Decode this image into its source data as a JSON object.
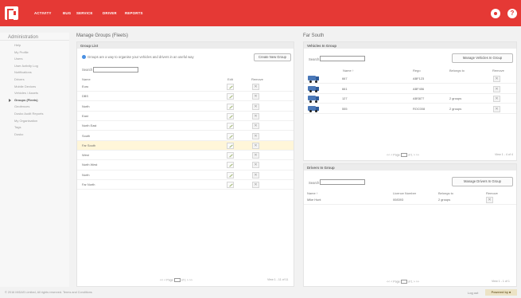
{
  "topbar": {
    "nav": [
      "ACTIVITY",
      "BUG",
      "SERVICE",
      "DRIVER",
      "REPORTS"
    ],
    "help_label": "?"
  },
  "sidebar": {
    "title": "Administration",
    "items": [
      "Help",
      "My Profile",
      "Users",
      "User Activity Log",
      "Notifications",
      "Drivers",
      "Mobile Devices",
      "Vehicles / Assets",
      "Groups (Fleets)",
      "Geofences",
      "Dusko Audit Reports",
      "My Organisation",
      "Tags",
      "Dusko"
    ]
  },
  "left": {
    "title": "Manage Groups (Fleets)",
    "list_header": "Group List",
    "info_text": "Groups are a way to organise your vehicles and drivers in an useful way",
    "create_button": "Create New Group",
    "search_label": "Search",
    "columns": [
      "Name",
      "Edit",
      "Remove"
    ],
    "rows": [
      "Euro",
      "DBS",
      "North",
      "East",
      "North East",
      "South",
      "Far South",
      "West",
      "North West",
      "North",
      "Far North"
    ],
    "remove_glyph": "✕",
    "pager": {
      "prev": "<< <",
      "page_label": "Page",
      "of": "of 1",
      "next": "> >>",
      "count": "View 1 - 11 of 11"
    }
  },
  "right": {
    "title": "Far South",
    "vehicles": {
      "header": "Vehicles In Group",
      "search_label": "Search",
      "manage_button": "Manage Vehicles In Group",
      "columns": [
        "Name ↑",
        "Rego",
        "Belongs to",
        "Remove"
      ],
      "rows": [
        {
          "name": "667",
          "rego": "ABF123",
          "belongs": ""
        },
        {
          "name": "661",
          "rego": "ABF456",
          "belongs": ""
        },
        {
          "name": "127",
          "rego": "ABS877",
          "belongs": "2 groups"
        },
        {
          "name": "555",
          "rego": "ROC008",
          "belongs": "2 groups"
        }
      ],
      "pager": {
        "prev": "<< <",
        "page_label": "Page",
        "of": "of 1",
        "next": "> >>",
        "count": "View 1 - 4 of 4"
      }
    },
    "drivers": {
      "header": "Drivers In Group",
      "search_label": "Search",
      "manage_button": "Manage Drivers In Group",
      "columns": [
        "Name ↑",
        "Licence Number",
        "Belongs to",
        "Remove"
      ],
      "rows": [
        {
          "name": "Mike Hunt",
          "licence": "008393",
          "belongs": "2 groups"
        }
      ],
      "pager": {
        "prev": "<< <",
        "page_label": "Page",
        "of": "of 1",
        "next": "> >>",
        "count": "View 1 - 1 of 1"
      }
    }
  },
  "footer": {
    "copyright": "© 2016 MIDAS Limited, All rights reserved.   Terms and Conditions",
    "logout": "Log out",
    "powered": "Powered by ■"
  }
}
